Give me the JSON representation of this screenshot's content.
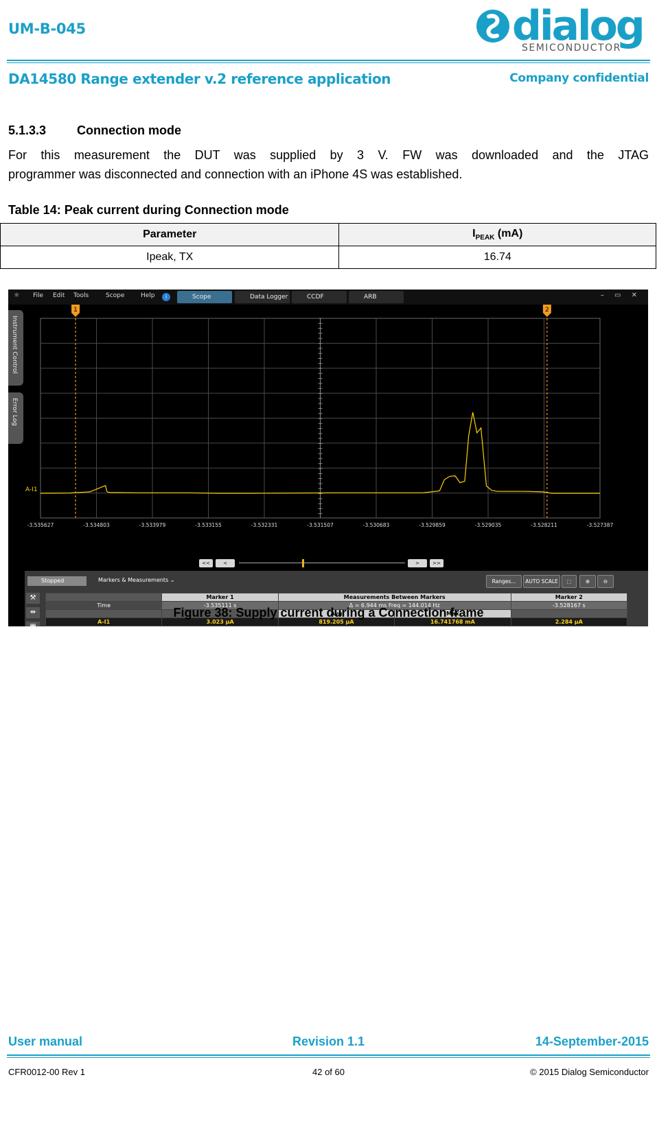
{
  "header": {
    "doc_code": "UM-B-045",
    "logo_word": "dialog",
    "logo_sub": "SEMICONDUCTOR",
    "doc_title": "DA14580 Range extender v.2 reference application",
    "confidentiality": "Company confidential"
  },
  "section": {
    "number": "5.1.3.3",
    "title": "Connection mode",
    "paragraph_line1": "For this measurement the DUT was supplied by 3 V. FW was downloaded and the JTAG",
    "paragraph_line2": "programmer was disconnected and connection with an iPhone 4S was established."
  },
  "table": {
    "caption": "Table 14: Peak current during Connection mode",
    "col1_header": "Parameter",
    "col2_header_main": "I",
    "col2_header_sub": "PEAK",
    "col2_header_unit": " (mA)",
    "row1_param": "Ipeak, TX",
    "row1_value": "16.74"
  },
  "scope": {
    "menu": [
      "File",
      "Edit",
      "Tools",
      "Scope",
      "Help"
    ],
    "tabs": [
      "Scope",
      "Data Logger",
      "CCDF",
      "ARB"
    ],
    "side_tabs": [
      "Instrument Control",
      "Error Log"
    ],
    "channel_label": "A-I1",
    "marker1_label": "1",
    "marker2_label": "2",
    "x_ticks": [
      "-3.535627",
      "-3.534803",
      "-3.533979",
      "-3.533155",
      "-3.532331",
      "-3.531507",
      "-3.530683",
      "-3.529859",
      "-3.529035",
      "-3.528211",
      "-3.527387"
    ],
    "nav_buttons": [
      "<<",
      "<",
      ">",
      ">>"
    ],
    "status": "Stopped",
    "markers_measurements": "Markers & Measurements",
    "buttons": [
      "Ranges...",
      "AUTO SCALE"
    ],
    "measure_table": {
      "col_marker1": "Marker 1",
      "col_between": "Measurements Between Markers",
      "col_marker2": "Marker 2",
      "time_label": "Time",
      "time_m1": "-3.535111 s",
      "delta": "Δ = 6.944 ms   Freq = 144.014 Hz",
      "time_m2": "-3.528167 s",
      "avg_label": "Avg",
      "max_label": "Max",
      "channel": "A-I1",
      "m1_value": "3.023 µA",
      "avg_value": "819.205 µA",
      "max_value": "16.741768 mA",
      "m2_value": "2.284 µA"
    }
  },
  "chart_data": {
    "type": "line",
    "title": "",
    "xlabel": "",
    "ylabel": "",
    "xlim": [
      -3.535627,
      -3.527387
    ],
    "x": [
      -3.535627,
      -3.5352,
      -3.5349,
      -3.53467,
      -3.53465,
      -3.53463,
      -3.5346,
      -3.5342,
      -3.5335,
      -3.533,
      -3.5325,
      -3.5318,
      -3.5312,
      -3.5305,
      -3.53,
      -3.52975,
      -3.52968,
      -3.5296,
      -3.52952,
      -3.52945,
      -3.52938,
      -3.52932,
      -3.52926,
      -3.5292,
      -3.52914,
      -3.52906,
      -3.52898,
      -3.5289,
      -3.5285,
      -3.52823,
      -3.5281,
      -3.5279,
      -3.5277,
      -3.527387
    ],
    "y_mA": [
      0.003,
      0.05,
      0.3,
      1.6,
      0.4,
      0.2,
      0.15,
      0.1,
      0.1,
      0.0,
      0.0,
      0.05,
      0.1,
      0.1,
      0.1,
      0.5,
      2.8,
      3.5,
      3.6,
      2.2,
      2.5,
      12.0,
      16.74,
      12.5,
      13.5,
      1.5,
      0.6,
      0.4,
      0.4,
      0.3,
      0.002,
      0.0,
      0.0,
      0.0
    ],
    "series_color": "#ffd200",
    "markers_x": [
      -3.535111,
      -3.528167
    ],
    "marker_color": "#f29a1f",
    "grid": true
  },
  "figure": {
    "caption": "Figure 38: Supply current during a Connection frame"
  },
  "footer": {
    "doc_type": "User manual",
    "revision": "Revision 1.1",
    "date": "14-September-2015",
    "form_code": "CFR0012-00 Rev 1",
    "page": "42 of 60",
    "copyright": "© 2015 Dialog Semiconductor"
  }
}
